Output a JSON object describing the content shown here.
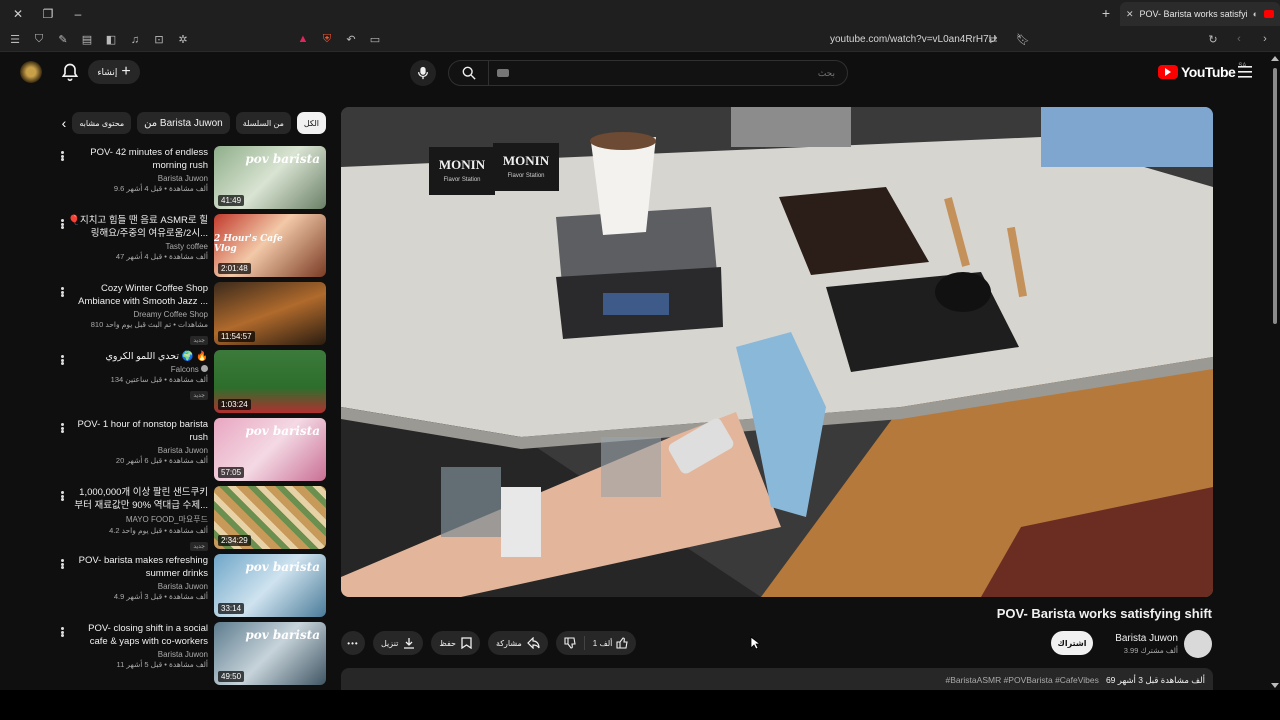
{
  "browser": {
    "tab_title": "POV- Barista works satisfying",
    "url": "youtube.com/watch?v=vL0an4RrH7U"
  },
  "header": {
    "create_label": "إنشاء",
    "search_placeholder": "بحث",
    "logo_text": "YouTube",
    "logo_region": "SA"
  },
  "chips": {
    "all": "الكل",
    "from_series": "من السلسلة",
    "from_channel": "من Barista Juwon",
    "related": "محتوى مشابه"
  },
  "recommendations": [
    {
      "title": "POV- 42 minutes of endless morning rush",
      "channel": "Barista Juwon",
      "meta": "9.6 ألف مشاهدة • قبل 4 أشهر",
      "duration": "41:49",
      "caption": "pov barista",
      "badge": ""
    },
    {
      "title": "🎈지치고 힘들 땐 음료 ASMR로 힐링해요/주중의 여유로움/2시...",
      "channel": "Tasty coffee",
      "meta": "47 ألف مشاهدة • قبل 4 أشهر",
      "duration": "2:01:48",
      "caption": "2 Hour's Cafe Vlog",
      "badge": ""
    },
    {
      "title": "Cozy Winter Coffee Shop Ambiance with Smooth Jazz ...",
      "channel": "Dreamy Coffee Shop",
      "meta": "810 مشاهدات • تم البث قبل يوم واحد",
      "duration": "11:54:57",
      "caption": "",
      "badge": "جديد"
    },
    {
      "title": "تحدي اللمو الكروي 🌍 🔥",
      "channel": "Falcons",
      "meta": "134 ألف مشاهدة • قبل ساعتين",
      "duration": "1:03:24",
      "caption": "",
      "badge": "جديد"
    },
    {
      "title": "POV- 1 hour of nonstop barista rush",
      "channel": "Barista Juwon",
      "meta": "20 ألف مشاهدة • قبل 6 أشهر",
      "duration": "57:05",
      "caption": "pov barista",
      "badge": ""
    },
    {
      "title": "1,000,000개 이상 팔린 샌드쿠키 부터 재료값만 90% 역대급 수제...",
      "channel": "MAYO FOOD_마요푸드",
      "meta": "4.2 ألف مشاهدة • قبل يوم واحد",
      "duration": "2:34:29",
      "caption": "",
      "badge": "جديد"
    },
    {
      "title": "POV- barista makes refreshing summer drinks",
      "channel": "Barista Juwon",
      "meta": "4.9 ألف مشاهدة • قبل 3 أشهر",
      "duration": "33:14",
      "caption": "pov barista",
      "badge": ""
    },
    {
      "title": "POV- closing shift in a social cafe & yaps with co-workers",
      "channel": "Barista Juwon",
      "meta": "11 ألف مشاهدة • قبل 5 أشهر",
      "duration": "49:50",
      "caption": "pov barista",
      "badge": ""
    }
  ],
  "video": {
    "title": "POV- Barista works satisfying shift",
    "channel_name": "Barista Juwon",
    "subscribers": "3.99 ألف مشترك",
    "subscribe_label": "اشتراك",
    "likes": "1 ألف",
    "share_label": "مشاركة",
    "save_label": "حفظ",
    "download_label": "تنزيل",
    "desc_stats": "69 ألف مشاهدة قبل 3 أشهر",
    "desc_tags": "#BaristaASMR #POVBarista #CafeVibes",
    "player_brand_1": "MONIN",
    "player_brand_1_sub": "Flavor Station",
    "player_brand_2": "MONIN",
    "player_brand_2_sub": "Flavor Station"
  },
  "colors": {
    "background": "#0f0f0f",
    "chip": "#272727",
    "brand_red": "#ff0000"
  }
}
